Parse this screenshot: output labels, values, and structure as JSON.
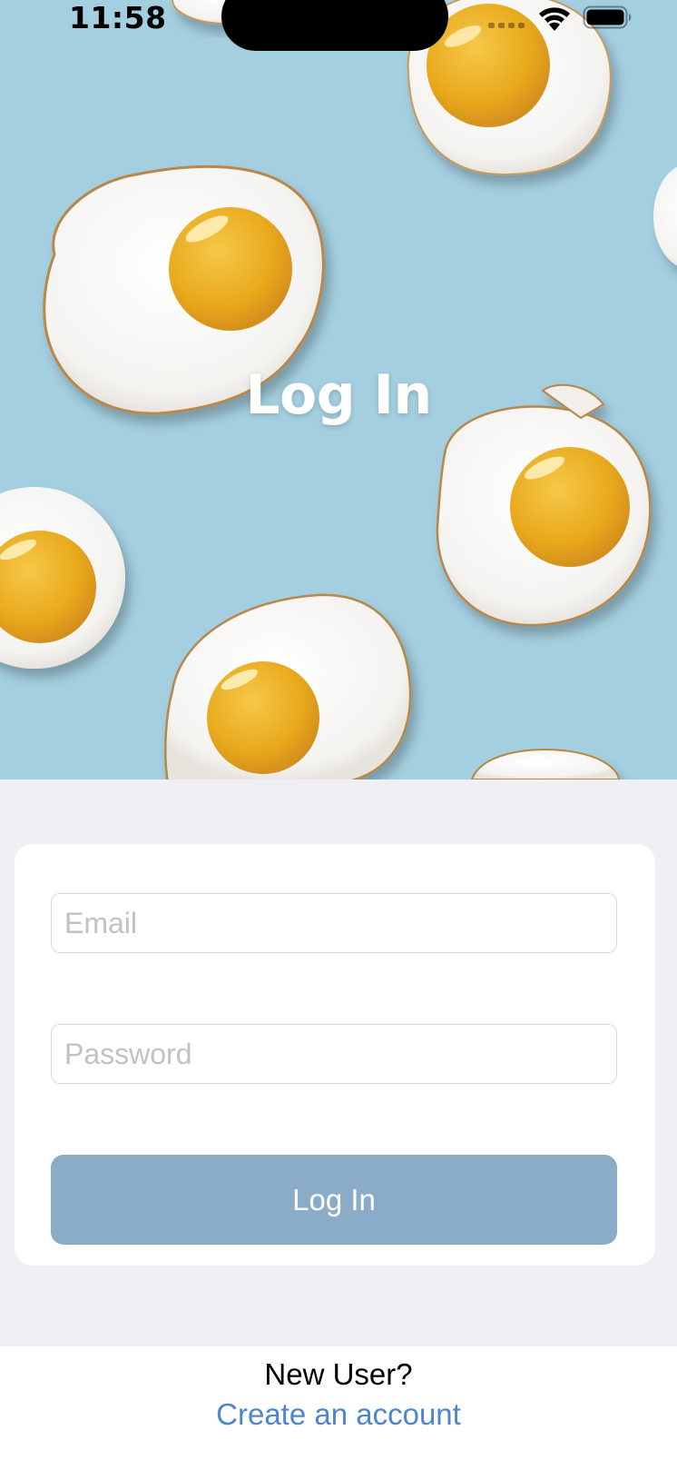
{
  "status_bar": {
    "time": "11:58"
  },
  "hero": {
    "title": "Log In",
    "background_color": "#A4CFE0",
    "image": "fried-eggs-on-blue"
  },
  "form": {
    "email": {
      "placeholder": "Email",
      "value": ""
    },
    "password": {
      "placeholder": "Password",
      "value": ""
    },
    "submit_label": "Log In",
    "submit_color": "#8AACC8"
  },
  "footer": {
    "prompt": "New User?",
    "link_label": "Create an account",
    "link_color": "#4F85CE"
  },
  "icons": {
    "signal": "cellular-signal-icon",
    "wifi": "wifi-icon",
    "battery": "battery-icon"
  }
}
